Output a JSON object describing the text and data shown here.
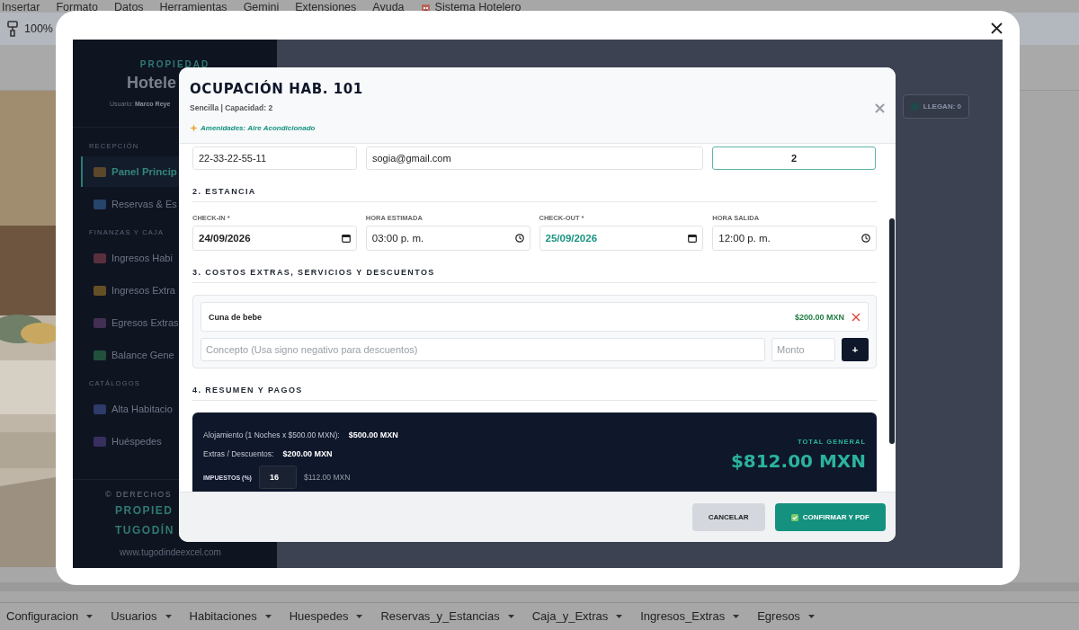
{
  "sheet_menu": [
    "Insertar",
    "Formato",
    "Datos",
    "Herramientas",
    "Gemini",
    "Extensiones",
    "Ayuda",
    "Sistema Hotelero"
  ],
  "toolbar": {
    "zoom": "100%"
  },
  "sidebar": {
    "kicker": "PROPIEDAD",
    "title": "Hotele",
    "user_label": "Usuario:",
    "user_name": "Marco Reye",
    "sections": [
      {
        "heading": "RECEPCIÓN",
        "items": [
          {
            "label": "Panel Princip",
            "selected": true
          },
          {
            "label": "Reservas & Es",
            "selected": false
          }
        ]
      },
      {
        "heading": "FINANZAS Y CAJA",
        "items": [
          {
            "label": "Ingresos Habi",
            "selected": false
          },
          {
            "label": "Ingresos Extra",
            "selected": false
          },
          {
            "label": "Egresos Extras",
            "selected": false
          },
          {
            "label": "Balance Gene",
            "selected": false
          }
        ]
      },
      {
        "heading": "CATÁLOGOS",
        "items": [
          {
            "label": "Alta Habitacio",
            "selected": false
          },
          {
            "label": "Huéspedes",
            "selected": false
          }
        ]
      }
    ],
    "footer": {
      "rights": "© DERECHOS",
      "owner_lines": [
        "PROPIED",
        "TUGODÍN"
      ],
      "website": "www.tugodindeexcel.com"
    }
  },
  "arrivals_badge": "LLEGAN: 0",
  "modal": {
    "title": "OCUPACIÓN HAB. 101",
    "subtitle": "Sencilla | Capacidad: 2",
    "amenities": "Amenidades: Aire Acondicionado",
    "contact_fields": [
      {
        "value": "22-33-22-55-11",
        "focused": false
      },
      {
        "value": "sogia@gmail.com",
        "focused": false
      },
      {
        "value": "2",
        "focused": true
      }
    ],
    "stay": {
      "heading": "2. ESTANCIA",
      "fields": [
        {
          "label": "CHECK-IN *",
          "value": "24/09/2026",
          "kind": "date",
          "highlight": false
        },
        {
          "label": "HORA ESTIMADA",
          "value": "03:00 p. m.",
          "kind": "time",
          "highlight": false
        },
        {
          "label": "CHECK-OUT *",
          "value": "25/09/2026",
          "kind": "date",
          "highlight": true
        },
        {
          "label": "HORA SALIDA",
          "value": "12:00 p. m.",
          "kind": "time",
          "highlight": false
        }
      ]
    },
    "extras": {
      "heading": "3. COSTOS EXTRAS, SERVICIOS Y DESCUENTOS",
      "items": [
        {
          "concept": "Cuna de bebe",
          "amount": "$200.00 MXN"
        }
      ],
      "concept_placeholder": "Concepto (Usa signo negativo para descuentos)",
      "amount_placeholder": "Monto",
      "add_label": "+"
    },
    "summary": {
      "heading": "4. RESUMEN Y PAGOS",
      "lodging_label": "Alojamiento (1 Noches x $500.00 MXN):",
      "lodging_value": "$500.00 MXN",
      "extras_label": "Extras / Descuentos:",
      "extras_value": "$200.00 MXN",
      "tax_label": "IMPUESTOS (%)",
      "tax_rate": "16",
      "tax_amount": "$112.00 MXN",
      "total_label": "TOTAL GENERAL",
      "total": "$812.00 MXN"
    },
    "buttons": [
      {
        "label": "CANCELAR",
        "kind": "secondary"
      },
      {
        "label": "CONFIRMAR Y PDF",
        "kind": "primary"
      }
    ]
  },
  "sheet_tabs": [
    "Configuracion",
    "Usuarios",
    "Habitaciones",
    "Huespedes",
    "Reservas_y_Estancias",
    "Caja_y_Extras",
    "Ingresos_Extras",
    "Egresos"
  ]
}
